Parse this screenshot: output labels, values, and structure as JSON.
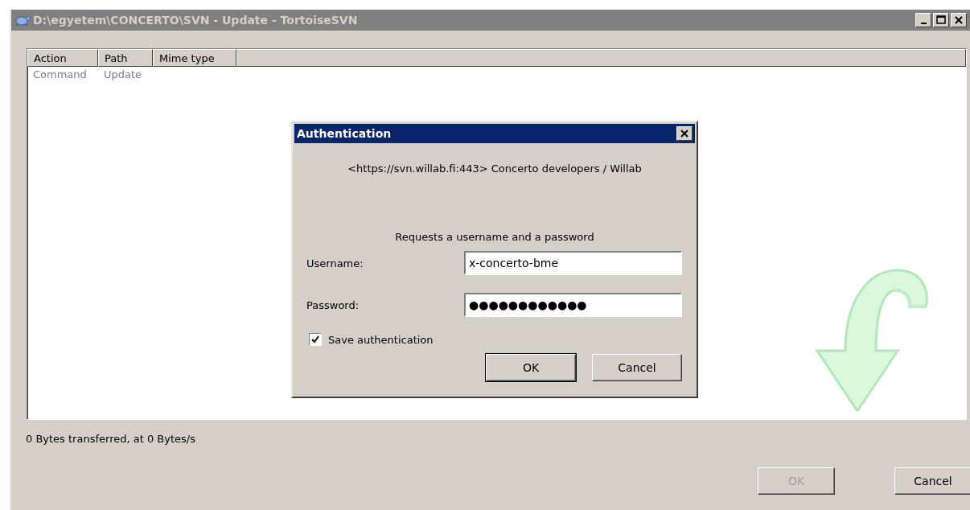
{
  "window": {
    "title": "D:\\egyetem\\CONCERTO\\SVN - Update - TortoiseSVN"
  },
  "table": {
    "columns": [
      "Action",
      "Path",
      "Mime type"
    ],
    "rows": [
      {
        "cells": [
          "Command",
          "Update"
        ]
      }
    ]
  },
  "status_bar": "0 Bytes transferred, at 0 Bytes/s",
  "buttons": [
    {
      "label": "OK",
      "disabled": true
    },
    {
      "label": "Cancel",
      "disabled": false
    }
  ],
  "dialog": {
    "title": "Authentication",
    "realm": "<https://svn.willab.fi:443> Concerto developers / Willab",
    "prompt": "Requests a username and a password",
    "fields": [
      {
        "label": "Username:",
        "value": "x-concerto-bme"
      },
      {
        "label": "Password:",
        "value": "●●●●●●●●●●●●"
      }
    ],
    "save": {
      "label": "Save authentication",
      "checked": true
    },
    "buttons": [
      {
        "label": "OK",
        "default": true
      },
      {
        "label": "Cancel",
        "default": false
      }
    ]
  }
}
